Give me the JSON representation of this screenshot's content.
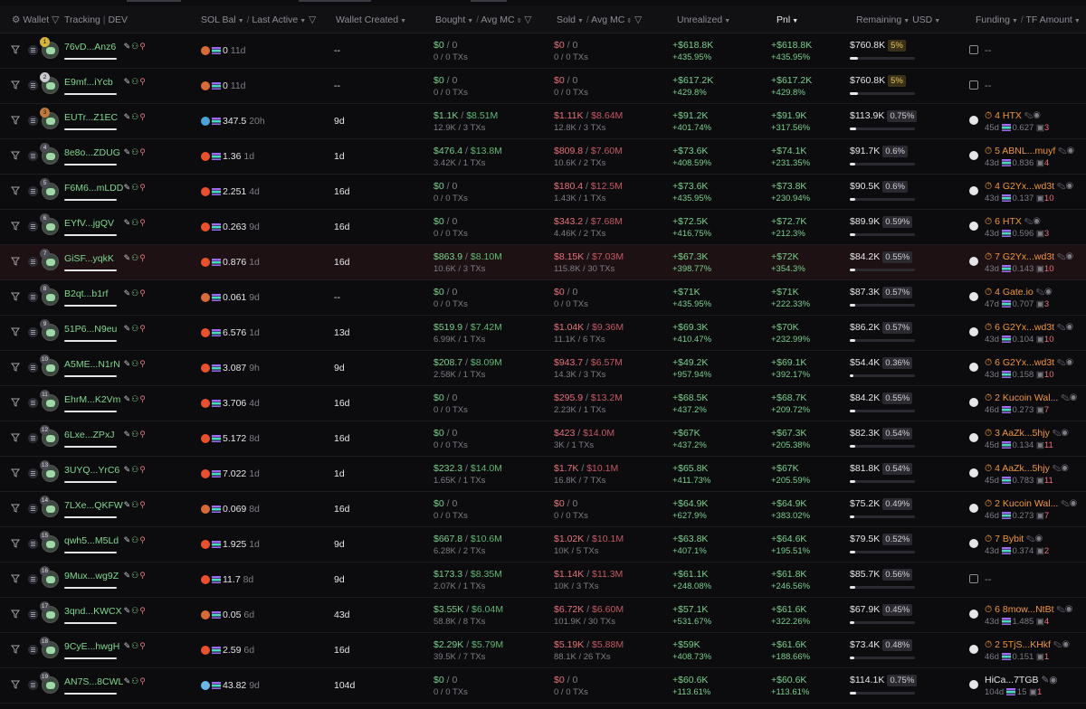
{
  "header": {
    "wallet": "Wallet",
    "tracking": "Tracking",
    "dev": "DEV",
    "sol_bal": "SOL Bal",
    "last_active": "Last Active",
    "wallet_created": "Wallet Created",
    "bought": "Bought",
    "avg_mc": "Avg MC",
    "sold": "Sold",
    "avg_mc2": "Avg MC",
    "unrealized": "Unrealized",
    "pnl": "Pnl",
    "remaining": "Remaining",
    "usd": "USD",
    "funding": "Funding",
    "tf_amount": "TF Amount"
  },
  "rows": [
    {
      "rank": "1",
      "wallet": "76vD...Anz6",
      "solbal": "0",
      "last": "11d",
      "created": "--",
      "bought": "$0",
      "bought_mc": "0",
      "bought_tx": "0 / 0 TXs",
      "sold": "$0",
      "sold_mc": "0",
      "sold_tx": "0 / 0 TXs",
      "unreal": "+$618.8K",
      "unreal_pct": "+435.95%",
      "pnl": "+$618.8K",
      "pnl_pct": "+435.95%",
      "remain": "$760.8K",
      "remain_pct": "5%",
      "remain_frac": 0.12,
      "funding": "--",
      "fund_days": "",
      "fund_amt": "",
      "fund_cnt": ""
    },
    {
      "rank": "2",
      "wallet": "E9mf...iYcb",
      "solbal": "0",
      "last": "11d",
      "created": "--",
      "bought": "$0",
      "bought_mc": "0",
      "bought_tx": "0 / 0 TXs",
      "sold": "$0",
      "sold_mc": "0",
      "sold_tx": "0 / 0 TXs",
      "unreal": "+$617.2K",
      "unreal_pct": "+429.8%",
      "pnl": "+$617.2K",
      "pnl_pct": "+429.8%",
      "remain": "$760.8K",
      "remain_pct": "5%",
      "remain_frac": 0.12,
      "funding": "--",
      "fund_days": "",
      "fund_amt": "",
      "fund_cnt": ""
    },
    {
      "rank": "3",
      "wallet": "EUTr...Z1EC",
      "solbal": "347.5",
      "last": "20h",
      "created": "9d",
      "bought": "$1.1K",
      "bought_mc": "$8.51M",
      "bought_tx": "12.9K / 3 TXs",
      "sold": "$1.11K",
      "sold_mc": "$8.64M",
      "sold_tx": "12.8K / 3 TXs",
      "unreal": "+$91.2K",
      "unreal_pct": "+401.74%",
      "pnl": "+$91.9K",
      "pnl_pct": "+317.56%",
      "remain": "$113.9K",
      "remain_pct": "0.75%",
      "remain_frac": 0.1,
      "funding": "4 HTX",
      "fund_days": "45d",
      "fund_amt": "0.627",
      "fund_cnt": "3"
    },
    {
      "rank": "4",
      "wallet": "8e8o...ZDUG",
      "solbal": "1.36",
      "last": "1d",
      "created": "1d",
      "bought": "$476.4",
      "bought_mc": "$13.8M",
      "bought_tx": "3.42K / 1 TXs",
      "sold": "$809.8",
      "sold_mc": "$7.60M",
      "sold_tx": "10.6K / 2 TXs",
      "unreal": "+$73.6K",
      "unreal_pct": "+408.59%",
      "pnl": "+$74.1K",
      "pnl_pct": "+231.35%",
      "remain": "$91.7K",
      "remain_pct": "0.6%",
      "remain_frac": 0.08,
      "funding": "5 ABNL...muyf",
      "fund_days": "43d",
      "fund_amt": "0.836",
      "fund_cnt": "4"
    },
    {
      "rank": "5",
      "wallet": "F6M6...mLDD",
      "solbal": "2.251",
      "last": "4d",
      "created": "16d",
      "bought": "$0",
      "bought_mc": "0",
      "bought_tx": "0 / 0 TXs",
      "sold": "$180.4",
      "sold_mc": "$12.5M",
      "sold_tx": "1.43K / 1 TXs",
      "unreal": "+$73.6K",
      "unreal_pct": "+435.95%",
      "pnl": "+$73.8K",
      "pnl_pct": "+230.94%",
      "remain": "$90.5K",
      "remain_pct": "0.6%",
      "remain_frac": 0.08,
      "funding": "4 G2Yx...wd3t",
      "fund_days": "43d",
      "fund_amt": "0.137",
      "fund_cnt": "10"
    },
    {
      "rank": "6",
      "wallet": "EYfV...jgQV",
      "solbal": "0.263",
      "last": "9d",
      "created": "16d",
      "bought": "$0",
      "bought_mc": "0",
      "bought_tx": "0 / 0 TXs",
      "sold": "$343.2",
      "sold_mc": "$7.68M",
      "sold_tx": "4.46K / 2 TXs",
      "unreal": "+$72.5K",
      "unreal_pct": "+416.75%",
      "pnl": "+$72.7K",
      "pnl_pct": "+212.3%",
      "remain": "$89.9K",
      "remain_pct": "0.59%",
      "remain_frac": 0.08,
      "funding": "6 HTX",
      "fund_days": "43d",
      "fund_amt": "0.596",
      "fund_cnt": "3"
    },
    {
      "rank": "7",
      "wallet": "GiSF...yqkK",
      "solbal": "0.876",
      "last": "1d",
      "created": "16d",
      "bought": "$863.9",
      "bought_mc": "$8.10M",
      "bought_tx": "10.6K / 3 TXs",
      "sold": "$8.15K",
      "sold_mc": "$7.03M",
      "sold_tx": "115.8K / 30 TXs",
      "unreal": "+$67.3K",
      "unreal_pct": "+398.77%",
      "pnl": "+$72K",
      "pnl_pct": "+354.3%",
      "remain": "$84.2K",
      "remain_pct": "0.55%",
      "remain_frac": 0.08,
      "funding": "7 G2Yx...wd3t",
      "fund_days": "43d",
      "fund_amt": "0.143",
      "fund_cnt": "10"
    },
    {
      "rank": "8",
      "wallet": "B2qt...b1rf",
      "solbal": "0.061",
      "last": "9d",
      "created": "--",
      "bought": "$0",
      "bought_mc": "0",
      "bought_tx": "0 / 0 TXs",
      "sold": "$0",
      "sold_mc": "0",
      "sold_tx": "0 / 0 TXs",
      "unreal": "+$71K",
      "unreal_pct": "+435.95%",
      "pnl": "+$71K",
      "pnl_pct": "+222.33%",
      "remain": "$87.3K",
      "remain_pct": "0.57%",
      "remain_frac": 0.08,
      "funding": "4 Gate.io",
      "fund_days": "47d",
      "fund_amt": "0.707",
      "fund_cnt": "3"
    },
    {
      "rank": "9",
      "wallet": "51P6...N9eu",
      "solbal": "6.576",
      "last": "1d",
      "created": "13d",
      "bought": "$519.9",
      "bought_mc": "$7.42M",
      "bought_tx": "6.99K / 1 TXs",
      "sold": "$1.04K",
      "sold_mc": "$9.36M",
      "sold_tx": "11.1K / 6 TXs",
      "unreal": "+$69.3K",
      "unreal_pct": "+410.47%",
      "pnl": "+$70K",
      "pnl_pct": "+232.99%",
      "remain": "$86.2K",
      "remain_pct": "0.57%",
      "remain_frac": 0.08,
      "funding": "6 G2Yx...wd3t",
      "fund_days": "43d",
      "fund_amt": "0.104",
      "fund_cnt": "10"
    },
    {
      "rank": "10",
      "wallet": "A5ME...N1rN",
      "solbal": "3.087",
      "last": "9h",
      "created": "9d",
      "bought": "$208.7",
      "bought_mc": "$8.09M",
      "bought_tx": "2.58K / 1 TXs",
      "sold": "$943.7",
      "sold_mc": "$6.57M",
      "sold_tx": "14.3K / 3 TXs",
      "unreal": "+$49.2K",
      "unreal_pct": "+957.94%",
      "pnl": "+$69.1K",
      "pnl_pct": "+392.17%",
      "remain": "$54.4K",
      "remain_pct": "0.36%",
      "remain_frac": 0.06,
      "funding": "6 G2Yx...wd3t",
      "fund_days": "43d",
      "fund_amt": "0.158",
      "fund_cnt": "10"
    },
    {
      "rank": "11",
      "wallet": "EhrM...K2Vm",
      "solbal": "3.706",
      "last": "4d",
      "created": "16d",
      "bought": "$0",
      "bought_mc": "0",
      "bought_tx": "0 / 0 TXs",
      "sold": "$295.9",
      "sold_mc": "$13.2M",
      "sold_tx": "2.23K / 1 TXs",
      "unreal": "+$68.5K",
      "unreal_pct": "+437.2%",
      "pnl": "+$68.7K",
      "pnl_pct": "+209.72%",
      "remain": "$84.2K",
      "remain_pct": "0.55%",
      "remain_frac": 0.08,
      "funding": "2 Kucoin Wal...",
      "fund_days": "46d",
      "fund_amt": "0.273",
      "fund_cnt": "7"
    },
    {
      "rank": "12",
      "wallet": "6Lxe...ZPxJ",
      "solbal": "5.172",
      "last": "8d",
      "created": "16d",
      "bought": "$0",
      "bought_mc": "0",
      "bought_tx": "0 / 0 TXs",
      "sold": "$423",
      "sold_mc": "$14.0M",
      "sold_tx": "3K / 1 TXs",
      "unreal": "+$67K",
      "unreal_pct": "+437.2%",
      "pnl": "+$67.3K",
      "pnl_pct": "+205.38%",
      "remain": "$82.3K",
      "remain_pct": "0.54%",
      "remain_frac": 0.08,
      "funding": "3 AaZk...5hjy",
      "fund_days": "45d",
      "fund_amt": "0.134",
      "fund_cnt": "11"
    },
    {
      "rank": "13",
      "wallet": "3UYQ...YrC6",
      "solbal": "7.022",
      "last": "1d",
      "created": "1d",
      "bought": "$232.3",
      "bought_mc": "$14.0M",
      "bought_tx": "1.65K / 1 TXs",
      "sold": "$1.7K",
      "sold_mc": "$10.1M",
      "sold_tx": "16.8K / 7 TXs",
      "unreal": "+$65.8K",
      "unreal_pct": "+411.73%",
      "pnl": "+$67K",
      "pnl_pct": "+205.59%",
      "remain": "$81.8K",
      "remain_pct": "0.54%",
      "remain_frac": 0.08,
      "funding": "4 AaZk...5hjy",
      "fund_days": "45d",
      "fund_amt": "0.783",
      "fund_cnt": "11"
    },
    {
      "rank": "14",
      "wallet": "7LXe...QKFW",
      "solbal": "0.069",
      "last": "8d",
      "created": "16d",
      "bought": "$0",
      "bought_mc": "0",
      "bought_tx": "0 / 0 TXs",
      "sold": "$0",
      "sold_mc": "0",
      "sold_tx": "0 / 0 TXs",
      "unreal": "+$64.9K",
      "unreal_pct": "+627.9%",
      "pnl": "+$64.9K",
      "pnl_pct": "+383.02%",
      "remain": "$75.2K",
      "remain_pct": "0.49%",
      "remain_frac": 0.07,
      "funding": "2 Kucoin Wal...",
      "fund_days": "46d",
      "fund_amt": "0.273",
      "fund_cnt": "7"
    },
    {
      "rank": "15",
      "wallet": "qwh5...M5Ld",
      "solbal": "1.925",
      "last": "1d",
      "created": "9d",
      "bought": "$667.8",
      "bought_mc": "$10.6M",
      "bought_tx": "6.28K / 2 TXs",
      "sold": "$1.02K",
      "sold_mc": "$10.1M",
      "sold_tx": "10K / 5 TXs",
      "unreal": "+$63.8K",
      "unreal_pct": "+407.1%",
      "pnl": "+$64.6K",
      "pnl_pct": "+195.51%",
      "remain": "$79.5K",
      "remain_pct": "0.52%",
      "remain_frac": 0.08,
      "funding": "7 Bybit",
      "fund_days": "43d",
      "fund_amt": "0.374",
      "fund_cnt": "2"
    },
    {
      "rank": "16",
      "wallet": "9Mux...wg9Z",
      "solbal": "11.7",
      "last": "8d",
      "created": "9d",
      "bought": "$173.3",
      "bought_mc": "$8.35M",
      "bought_tx": "2.07K / 1 TXs",
      "sold": "$1.14K",
      "sold_mc": "$11.3M",
      "sold_tx": "10K / 3 TXs",
      "unreal": "+$61.1K",
      "unreal_pct": "+248.08%",
      "pnl": "+$61.8K",
      "pnl_pct": "+246.56%",
      "remain": "$85.7K",
      "remain_pct": "0.56%",
      "remain_frac": 0.08,
      "funding": "--",
      "fund_days": "",
      "fund_amt": "",
      "fund_cnt": ""
    },
    {
      "rank": "17",
      "wallet": "3qnd...KWCX",
      "solbal": "0.05",
      "last": "6d",
      "created": "43d",
      "bought": "$3.55K",
      "bought_mc": "$6.04M",
      "bought_tx": "58.8K / 8 TXs",
      "sold": "$6.72K",
      "sold_mc": "$6.60M",
      "sold_tx": "101.9K / 30 TXs",
      "unreal": "+$57.1K",
      "unreal_pct": "+531.67%",
      "pnl": "+$61.6K",
      "pnl_pct": "+322.26%",
      "remain": "$67.9K",
      "remain_pct": "0.45%",
      "remain_frac": 0.07,
      "funding": "6 8mow...NtBt",
      "fund_days": "43d",
      "fund_amt": "1.485",
      "fund_cnt": "4"
    },
    {
      "rank": "18",
      "wallet": "9CyE...hwgH",
      "solbal": "2.59",
      "last": "6d",
      "created": "16d",
      "bought": "$2.29K",
      "bought_mc": "$5.79M",
      "bought_tx": "39.5K / 7 TXs",
      "sold": "$5.19K",
      "sold_mc": "$5.88M",
      "sold_tx": "88.1K / 26 TXs",
      "unreal": "+$59K",
      "unreal_pct": "+408.73%",
      "pnl": "+$61.6K",
      "pnl_pct": "+188.66%",
      "remain": "$73.4K",
      "remain_pct": "0.48%",
      "remain_frac": 0.07,
      "funding": "2 5TjS...KHkf",
      "fund_days": "46d",
      "fund_amt": "0.151",
      "fund_cnt": "1"
    },
    {
      "rank": "19",
      "wallet": "AN7S...8CWL",
      "solbal": "43.82",
      "last": "9d",
      "created": "104d",
      "bought": "$0",
      "bought_mc": "0",
      "bought_tx": "0 / 0 TXs",
      "sold": "$0",
      "sold_mc": "0",
      "sold_tx": "0 / 0 TXs",
      "unreal": "+$60.6K",
      "unreal_pct": "+113.61%",
      "pnl": "+$60.6K",
      "pnl_pct": "+113.61%",
      "remain": "$114.1K",
      "remain_pct": "0.75%",
      "remain_frac": 0.1,
      "funding": "HiCa...7TGB",
      "fund_days": "104d",
      "fund_amt": "15",
      "fund_cnt": "1"
    }
  ]
}
